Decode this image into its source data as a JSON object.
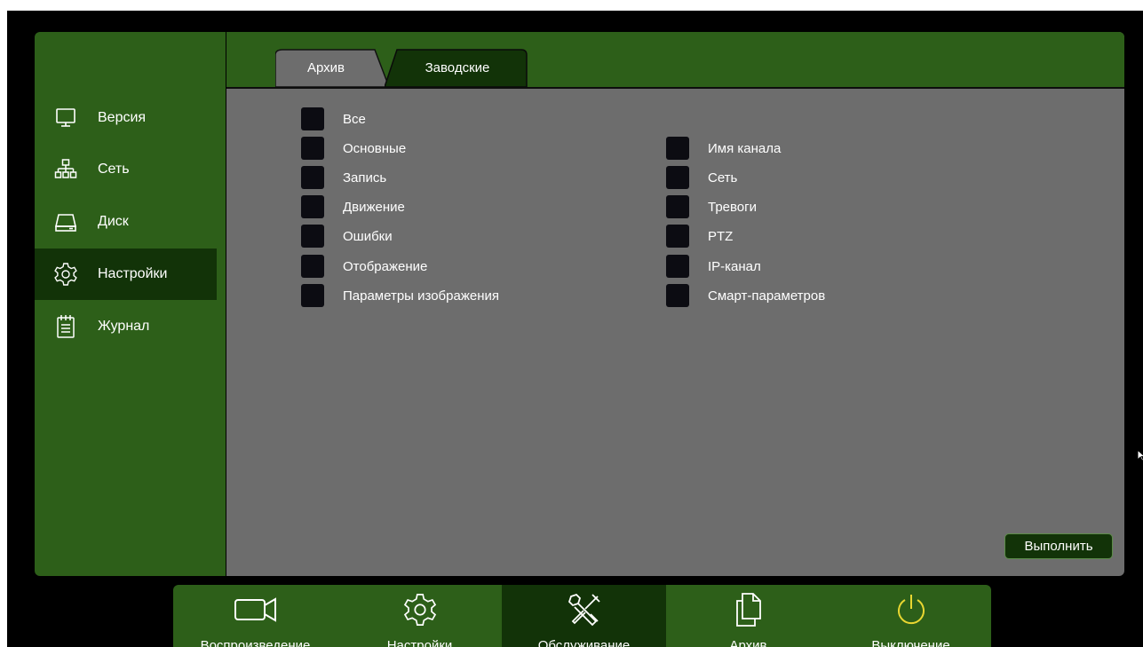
{
  "sidebar": {
    "items": [
      {
        "label": "Версия",
        "icon": "monitor-icon"
      },
      {
        "label": "Сеть",
        "icon": "network-icon"
      },
      {
        "label": "Диск",
        "icon": "disk-icon"
      },
      {
        "label": "Настройки",
        "icon": "gear-icon",
        "active": true
      },
      {
        "label": "Журнал",
        "icon": "journal-icon"
      }
    ]
  },
  "tabs": [
    {
      "label": "Архив"
    },
    {
      "label": "Заводские",
      "active": true
    }
  ],
  "options": {
    "left": [
      {
        "label": "Все",
        "checked": false
      },
      {
        "label": "Основные",
        "checked": false
      },
      {
        "label": "Запись",
        "checked": false
      },
      {
        "label": "Движение",
        "checked": false
      },
      {
        "label": "Ошибки",
        "checked": false
      },
      {
        "label": "Отображение",
        "checked": false
      },
      {
        "label": "Параметры изображения",
        "checked": false
      }
    ],
    "right": [
      {
        "label": "Имя канала",
        "checked": false
      },
      {
        "label": "Сеть",
        "checked": false
      },
      {
        "label": "Тревоги",
        "checked": false
      },
      {
        "label": "PTZ",
        "checked": false
      },
      {
        "label": "IP-канал",
        "checked": false
      },
      {
        "label": "Смарт-параметров",
        "checked": false
      }
    ]
  },
  "actions": {
    "run_label": "Выполнить"
  },
  "dock": {
    "items": [
      {
        "label": "Воспроизведение",
        "icon": "camera-icon"
      },
      {
        "label": "Настройки",
        "icon": "gear-icon"
      },
      {
        "label": "Обслуживание",
        "icon": "tools-icon",
        "active": true
      },
      {
        "label": "Архив",
        "icon": "documents-icon"
      },
      {
        "label": "Выключение",
        "icon": "power-icon"
      }
    ]
  },
  "colors": {
    "menu_green": "#2d5f19",
    "active_green": "#123308",
    "panel_gray": "#6d6d6d",
    "checkbox": "#0c0c12",
    "power_icon": "#e8d631",
    "text": "#ffffff"
  }
}
